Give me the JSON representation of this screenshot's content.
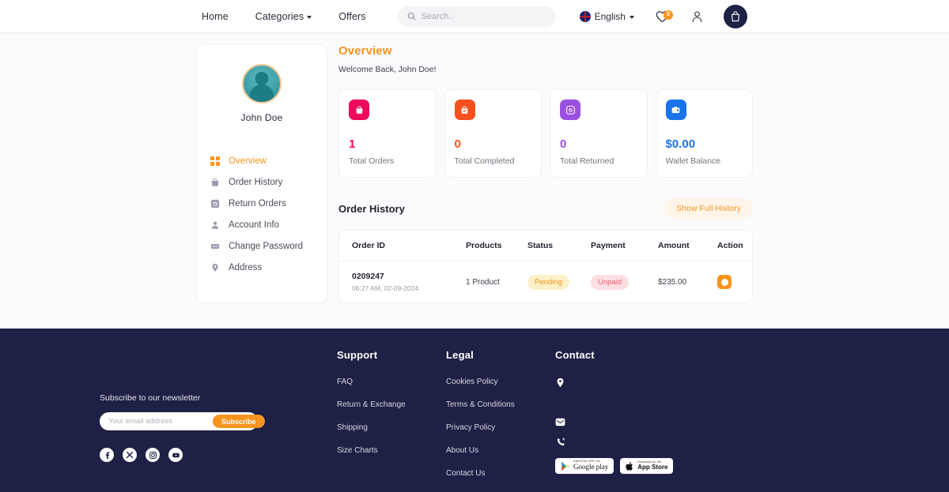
{
  "header": {
    "nav": [
      {
        "label": "Home",
        "has_chevron": false
      },
      {
        "label": "Categories",
        "has_chevron": true
      },
      {
        "label": "Offers",
        "has_chevron": false
      }
    ],
    "search": {
      "placeholder": "Search..",
      "value": "",
      "icon": "search-icon"
    },
    "language": {
      "label": "English",
      "icon": "uk-flag-icon"
    },
    "wishlist": {
      "icon": "heart-icon",
      "count": "0"
    },
    "account": {
      "icon": "user-icon"
    },
    "cart": {
      "icon": "bag-icon"
    }
  },
  "sidebar": {
    "avatar": {
      "icon": "user-avatar"
    },
    "user_name": "John Doe",
    "items": [
      {
        "label": "Overview",
        "icon": "grid-icon",
        "active": true
      },
      {
        "label": "Order History",
        "icon": "bag-icon",
        "active": false
      },
      {
        "label": "Return Orders",
        "icon": "return-icon",
        "active": false
      },
      {
        "label": "Account Info",
        "icon": "user-icon",
        "active": false
      },
      {
        "label": "Change Password",
        "icon": "password-icon",
        "active": false
      },
      {
        "label": "Address",
        "icon": "location-pin-icon",
        "active": false
      }
    ]
  },
  "overview": {
    "title": "Overview",
    "welcome": "Welcome Back, John Doe!",
    "cards": [
      {
        "value": "1",
        "label": "Total Orders",
        "color": "#ec0a5c",
        "icon": "bag-icon"
      },
      {
        "value": "0",
        "label": "Total Completed",
        "color": "#f4511e",
        "icon": "bag-check-icon"
      },
      {
        "value": "0",
        "label": "Total Returned",
        "color": "#9b51e0",
        "icon": "return-icon"
      },
      {
        "value": "$0.00",
        "label": "Wallet Balance",
        "color": "#1a73e8",
        "icon": "wallet-icon"
      }
    ]
  },
  "order_history": {
    "title": "Order History",
    "show_full_label": "Show Full History",
    "columns": [
      "Order ID",
      "Products",
      "Status",
      "Payment",
      "Amount",
      "Action"
    ],
    "rows": [
      {
        "order_id": "0209247",
        "order_date": "06:27 AM, 02-09-2024",
        "products": "1 Product",
        "status": "Pending",
        "payment": "Unpaid",
        "amount": "$235.00",
        "action_icon": "view-icon"
      }
    ]
  },
  "footer": {
    "newsletter": {
      "label": "Subscribe to our newsletter",
      "placeholder": "Your email address",
      "value": "",
      "button": "Subscribe"
    },
    "social": [
      {
        "name": "facebook-icon"
      },
      {
        "name": "x-twitter-icon"
      },
      {
        "name": "instagram-icon"
      },
      {
        "name": "youtube-icon"
      }
    ],
    "columns": [
      {
        "heading": "Support",
        "links": [
          "FAQ",
          "Return & Exchange",
          "Shipping",
          "Size Charts"
        ]
      },
      {
        "heading": "Legal",
        "links": [
          "Cookies Policy",
          "Terms & Conditions",
          "Privacy Policy",
          "About Us",
          "Contact Us"
        ]
      }
    ],
    "contact": {
      "heading": "Contact",
      "icons": [
        "location-pin-icon",
        "mail-icon",
        "phone-icon"
      ],
      "stores": [
        {
          "top": "ANDROID APP ON",
          "main": "Google play",
          "icon": "google-play-icon"
        },
        {
          "top": "Download on the",
          "main": "App Store",
          "icon": "apple-icon"
        }
      ]
    }
  }
}
